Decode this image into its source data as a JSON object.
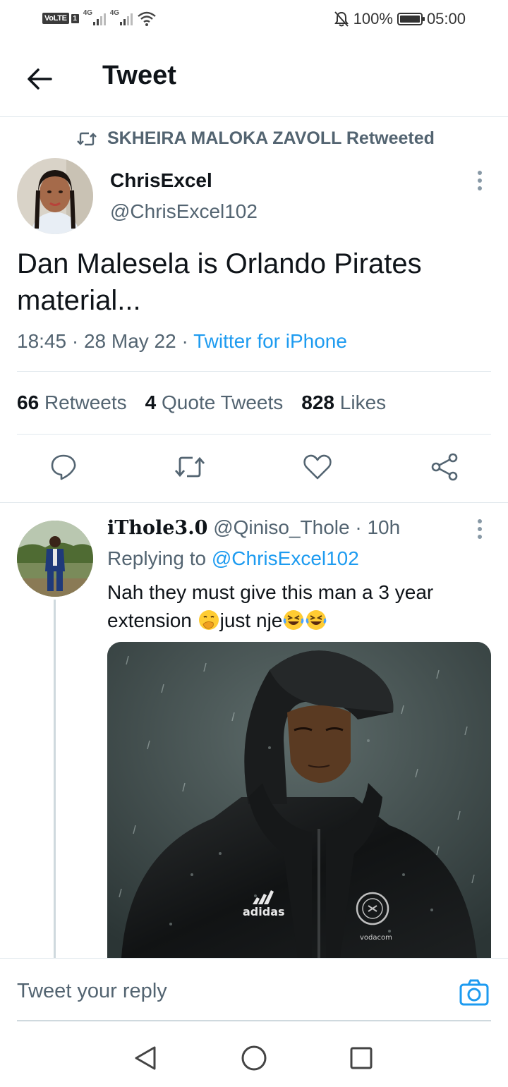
{
  "status_bar": {
    "volte": "VoLTE",
    "sim": "1",
    "network1": "4G",
    "network2": "4G",
    "battery": "100%",
    "time": "05:00"
  },
  "header": {
    "title": "Tweet"
  },
  "tweet": {
    "retweeted_by": "SKHEIRA MALOKA ZAVOLL Retweeted",
    "author_name": "ChrisExcel",
    "author_handle": "@ChrisExcel102",
    "text": "Dan Malesela is Orlando Pirates material...",
    "time": "18:45 · 28 May 22 · ",
    "source": "Twitter for iPhone",
    "stats": {
      "retweets_count": "66",
      "retweets_label": "Retweets",
      "quotes_count": "4",
      "quotes_label": "Quote Tweets",
      "likes_count": "828",
      "likes_label": "Likes"
    }
  },
  "reply": {
    "author_name": "iThole3.0",
    "author_handle": "@Qiniso_Thole",
    "time": "· 10h",
    "replying_prefix": "Replying to ",
    "replying_to": "@ChrisExcel102",
    "text_part1": "Nah they must give this man a 3 year extension ",
    "text_part2": "just nje",
    "image_text": {
      "brand": "adidas",
      "sponsor": "vodacom"
    }
  },
  "reply_bar": {
    "placeholder": "Tweet your reply"
  },
  "colors": {
    "accent": "#1d9bf0",
    "text_primary": "#0f1419",
    "text_secondary": "#536471",
    "divider": "#e1e8ed"
  },
  "icons": [
    "muted-bell-icon",
    "back-arrow-icon",
    "retweet-icon",
    "more-vertical-icon",
    "reply-icon",
    "like-icon",
    "share-icon",
    "camera-icon",
    "nav-back-icon",
    "nav-home-icon",
    "nav-recents-icon"
  ]
}
